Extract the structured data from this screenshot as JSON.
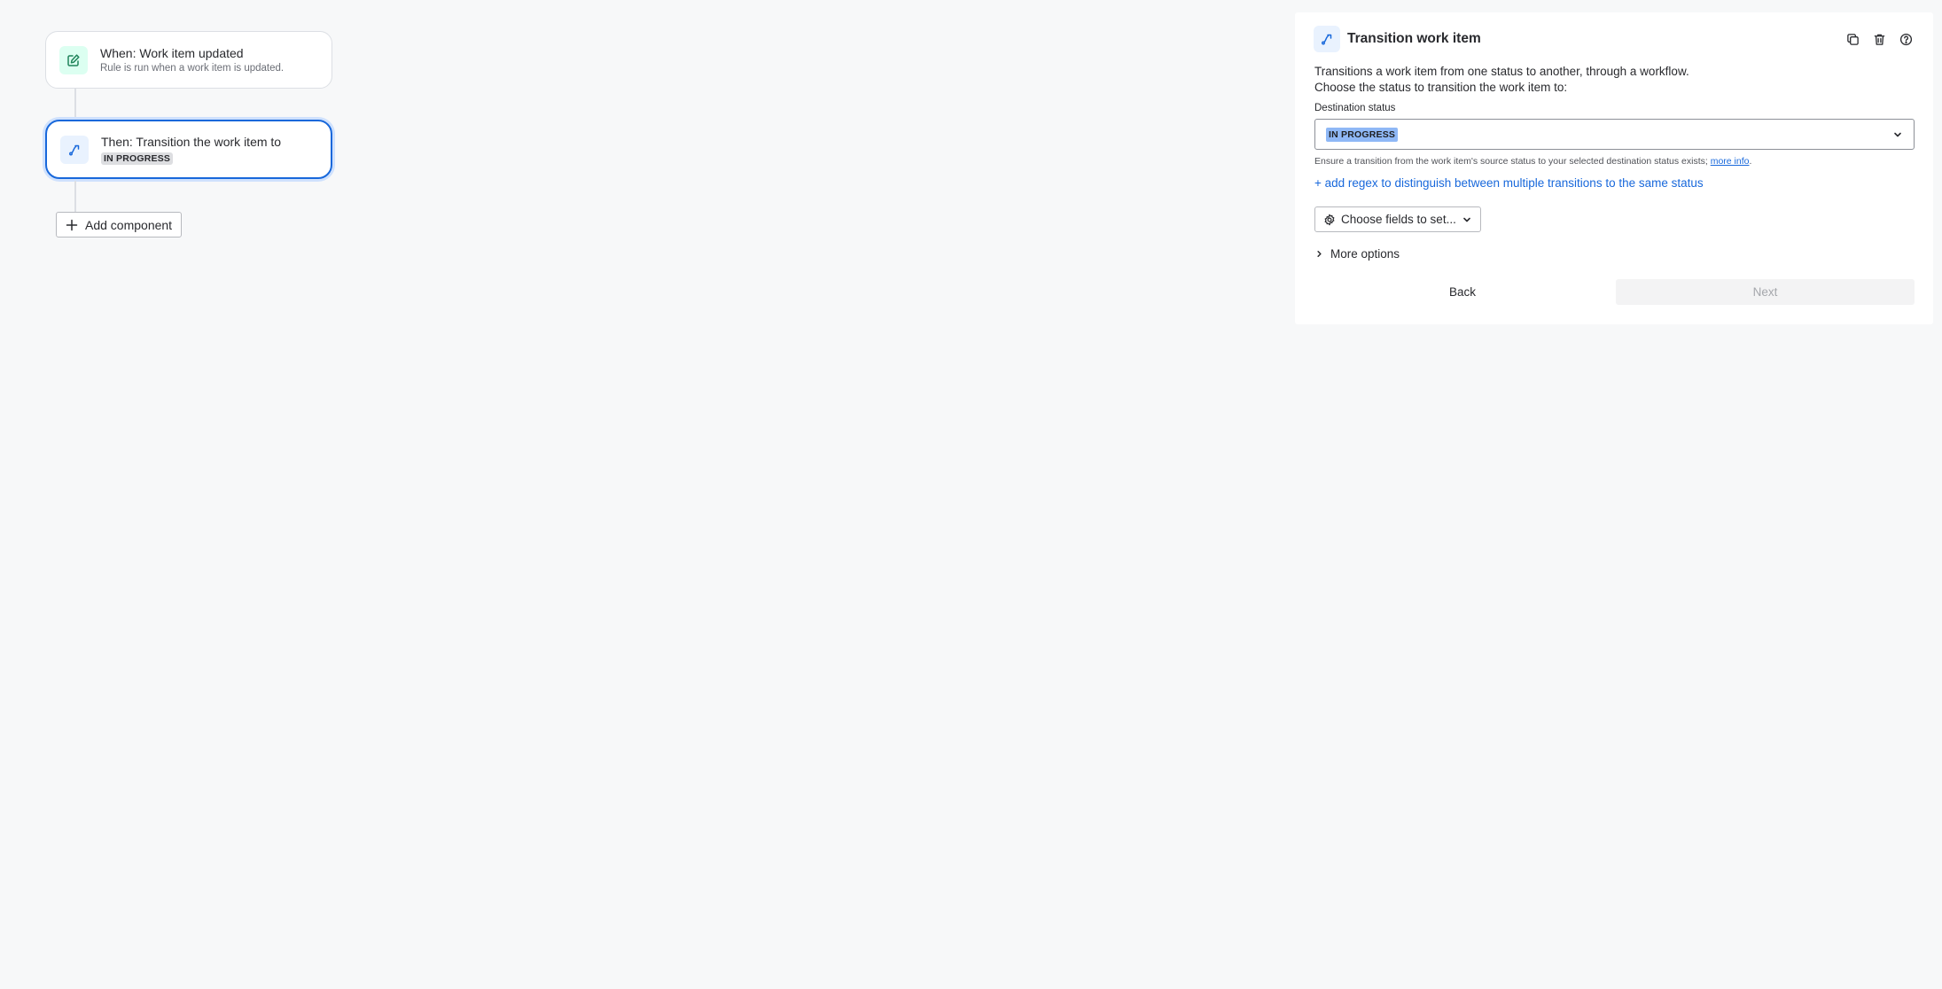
{
  "flow": {
    "trigger": {
      "title": "When: Work item updated",
      "subtitle": "Rule is run when a work item is updated.",
      "icon": "edit-icon"
    },
    "action": {
      "title": "Then: Transition the work item to",
      "status": "IN PROGRESS",
      "icon": "transition-icon"
    },
    "add_component_label": "Add component"
  },
  "panel": {
    "title": "Transition work item",
    "description_line1": "Transitions a work item from one status to another, through a workflow.",
    "description_line2": "Choose the status to transition the work item to:",
    "destination_label": "Destination status",
    "destination_value": "IN PROGRESS",
    "hint_text": "Ensure a transition from the work item's source status to your selected destination status exists;",
    "hint_link": "more info",
    "hint_end": ".",
    "regex_link": "+ add regex to distinguish between multiple transitions to the same status",
    "choose_fields_label": "Choose fields to set...",
    "more_options_label": "More options",
    "back_label": "Back",
    "next_label": "Next"
  },
  "colors": {
    "accent": "#1868db",
    "background": "#f7f8f9",
    "trigger_icon_bg": "#dcfff1",
    "action_icon_bg": "#e9f2fe"
  }
}
